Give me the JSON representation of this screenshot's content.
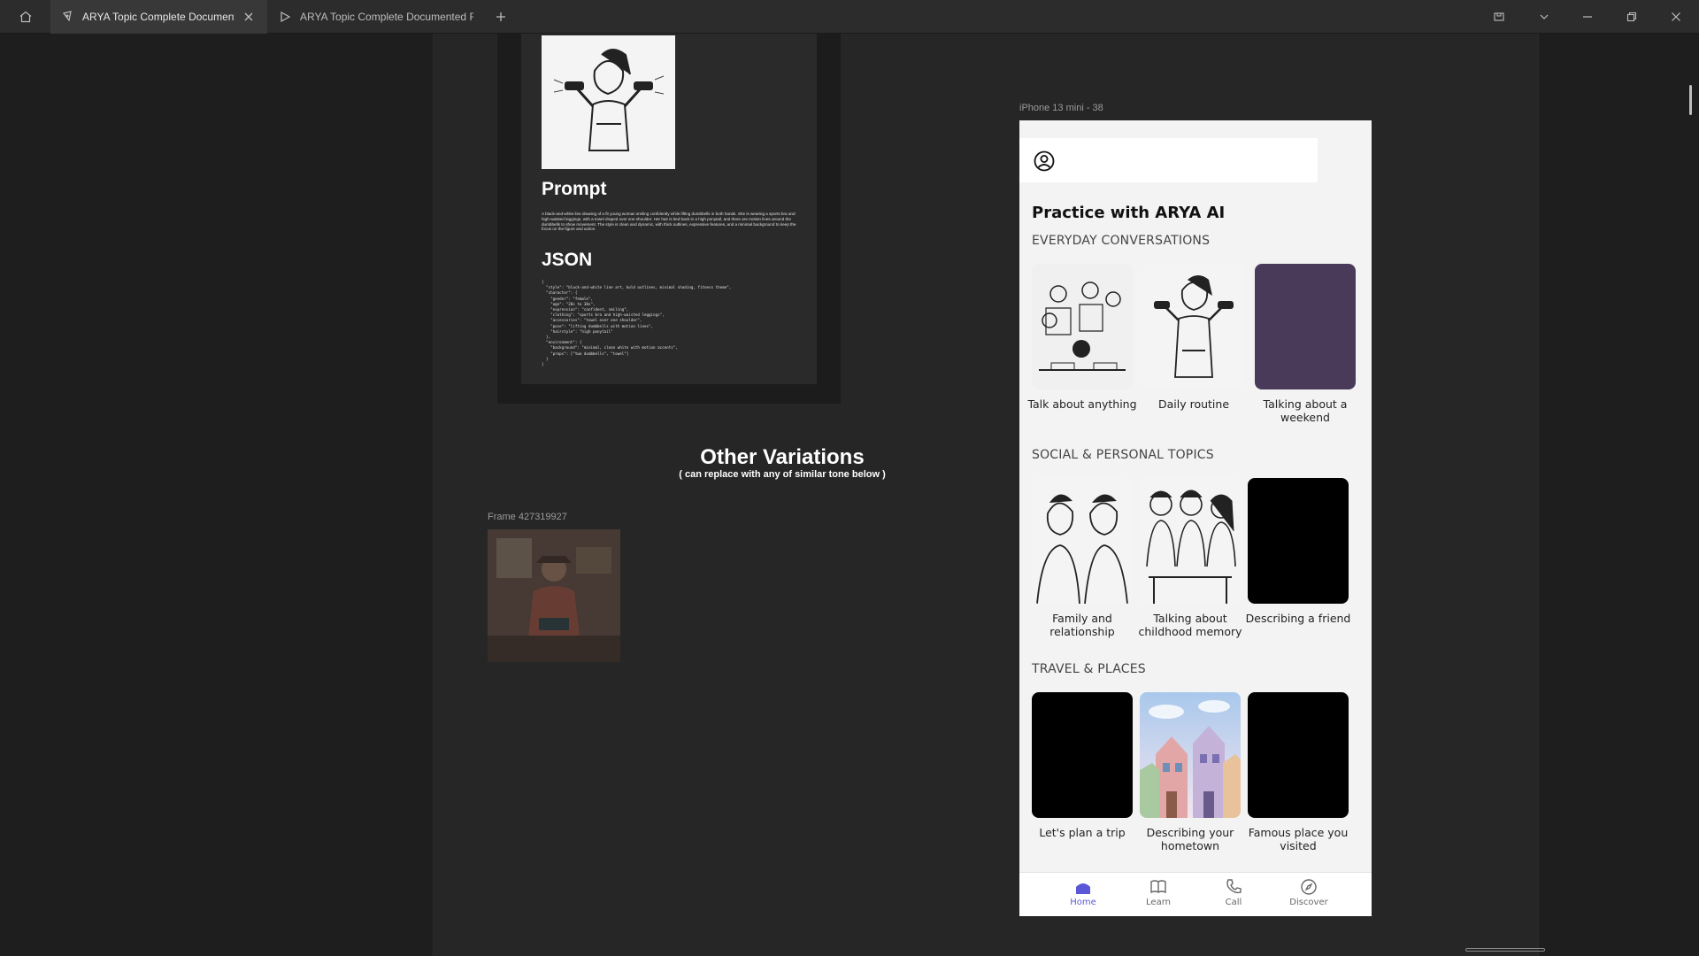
{
  "tabs": [
    {
      "label": "ARYA Topic Complete Documented File",
      "active": true
    },
    {
      "label": "ARYA Topic Complete Documented File",
      "active": false
    }
  ],
  "document": {
    "prompt_heading": "Prompt",
    "prompt_text": "A black-and-white line drawing of a fit young woman smiling confidently while lifting dumbbells in both hands. She is wearing a sports bra and high-waisted leggings, with a towel draped over one shoulder. Her hair is tied back in a high ponytail, and there are motion lines around the dumbbells to show movement. The style is clean and dynamic, with thick outlines, expressive features, and a minimal background to keep the focus on the figure and action.",
    "json_heading": "JSON",
    "json_text": "{\n  \"style\": \"black-and-white line art, bold outlines, minimal shading, fitness theme\",\n  \"character\": {\n    \"gender\": \"female\",\n    \"age\": \"20s to 30s\",\n    \"expression\": \"confident, smiling\",\n    \"clothing\": \"sports bra and high-waisted leggings\",\n    \"accessories\": \"towel over one shoulder\",\n    \"pose\": \"lifting dumbbells with motion lines\",\n    \"hairstyle\": \"high ponytail\"\n  },\n  \"environment\": {\n    \"background\": \"minimal, clean white with motion accents\",\n    \"props\": [\"two dumbbells\", \"towel\"]\n  }\n}"
  },
  "variations": {
    "title": "Other Variations",
    "subtitle": "( can replace with any of similar tone below )",
    "frame_label": "Frame 427319927"
  },
  "phone": {
    "frame_label": "iPhone 13 mini - 38",
    "title": "Practice with ARYA AI",
    "sections": [
      {
        "heading": "EVERYDAY CONVERSATIONS",
        "cards": [
          "Talk about anything",
          "Daily routine",
          "Talking about a weekend"
        ]
      },
      {
        "heading": "SOCIAL & PERSONAL TOPICS",
        "cards": [
          "Family and relationship",
          "Talking about childhood memory",
          "Describing a friend"
        ]
      },
      {
        "heading": "TRAVEL & PLACES",
        "cards": [
          "Let's plan a trip",
          "Describing your hometown",
          "Famous place you visited"
        ]
      }
    ],
    "nav": [
      "Home",
      "Learn",
      "Call",
      "Discover"
    ],
    "accent": "#5b57d9"
  }
}
